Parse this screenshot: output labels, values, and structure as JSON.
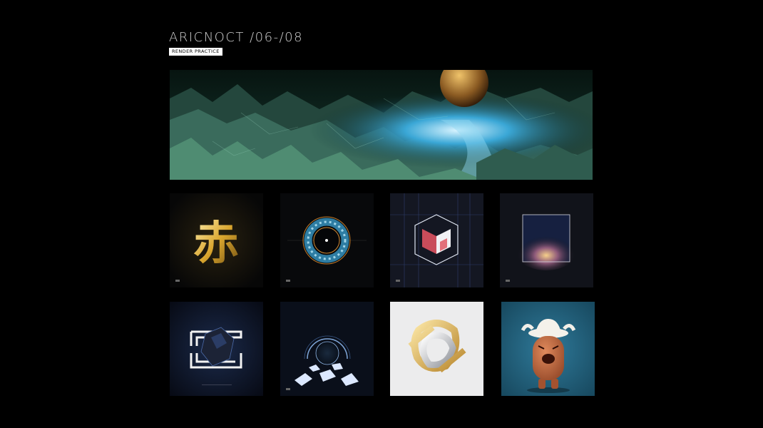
{
  "header": {
    "title": "ARICNOCT /06-/08",
    "tag": "RENDER PRACTICE"
  },
  "colors": {
    "background": "#000000",
    "title": "#cfcfcf",
    "tag_bg": "#ffffff"
  },
  "gallery": {
    "hero": {
      "icon": "fractal-landscape-image"
    },
    "row1": [
      {
        "icon": "golden-kanji-image",
        "kanji": "赤"
      },
      {
        "icon": "jeweled-ring-image"
      },
      {
        "icon": "prism-cube-image"
      },
      {
        "icon": "nebula-frame-image"
      }
    ],
    "row2": [
      {
        "icon": "rock-frame-image"
      },
      {
        "icon": "glowing-sphere-image"
      },
      {
        "icon": "metal-knot-image"
      },
      {
        "icon": "bull-character-image"
      }
    ]
  }
}
